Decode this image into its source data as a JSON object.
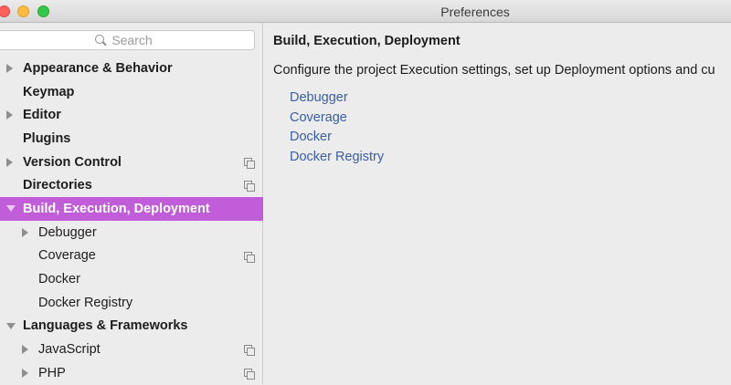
{
  "window": {
    "title": "Preferences"
  },
  "search": {
    "placeholder": "Search"
  },
  "sidebar": {
    "items": [
      {
        "label": "Appearance & Behavior",
        "level": 0,
        "arrow": "right",
        "bold": true,
        "copy": false
      },
      {
        "label": "Keymap",
        "level": 0,
        "arrow": "none",
        "bold": true,
        "copy": false
      },
      {
        "label": "Editor",
        "level": 0,
        "arrow": "right",
        "bold": true,
        "copy": false
      },
      {
        "label": "Plugins",
        "level": 0,
        "arrow": "none",
        "bold": true,
        "copy": false
      },
      {
        "label": "Version Control",
        "level": 0,
        "arrow": "right",
        "bold": true,
        "copy": true
      },
      {
        "label": "Directories",
        "level": 0,
        "arrow": "none",
        "bold": true,
        "copy": true
      },
      {
        "label": "Build, Execution, Deployment",
        "level": 0,
        "arrow": "down",
        "bold": true,
        "copy": false,
        "selected": true
      },
      {
        "label": "Debugger",
        "level": 1,
        "arrow": "right",
        "bold": false,
        "copy": false
      },
      {
        "label": "Coverage",
        "level": 1,
        "arrow": "none",
        "bold": false,
        "copy": true
      },
      {
        "label": "Docker",
        "level": 1,
        "arrow": "none",
        "bold": false,
        "copy": false
      },
      {
        "label": "Docker Registry",
        "level": 1,
        "arrow": "none",
        "bold": false,
        "copy": false
      },
      {
        "label": "Languages & Frameworks",
        "level": 0,
        "arrow": "down",
        "bold": true,
        "copy": false
      },
      {
        "label": "JavaScript",
        "level": 1,
        "arrow": "right",
        "bold": false,
        "copy": true
      },
      {
        "label": "PHP",
        "level": 1,
        "arrow": "right",
        "bold": false,
        "copy": true
      }
    ]
  },
  "main": {
    "title": "Build, Execution, Deployment",
    "description": "Configure the project Execution settings, set up Deployment options and cu",
    "links": [
      "Debugger",
      "Coverage",
      "Docker",
      "Docker Registry"
    ]
  },
  "colors": {
    "selection": "#c25dd9",
    "link": "#3a5fa5"
  }
}
